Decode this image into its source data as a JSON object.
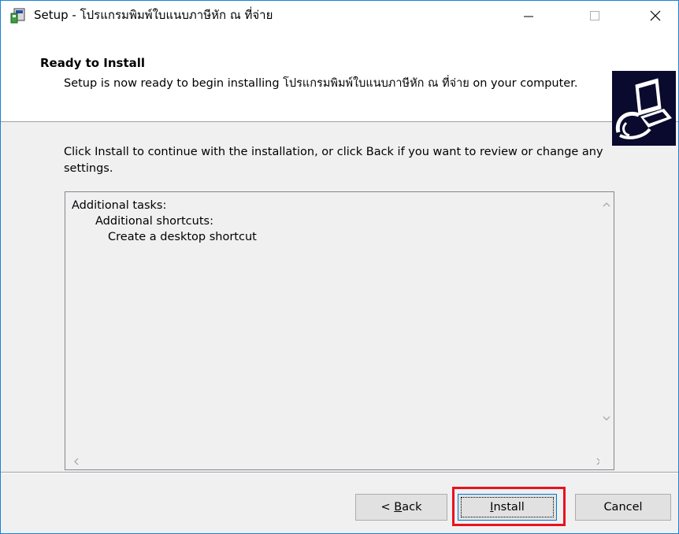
{
  "window": {
    "title": "Setup - โปรแกรมพิมพ์ใบแนบภาษีหัก ณ ที่จ่าย"
  },
  "header": {
    "title": "Ready to Install",
    "description": "Setup is now ready to begin installing โปรแกรมพิมพ์ใบแนบภาษีหัก ณ ที่จ่าย on your computer."
  },
  "body": {
    "instructions": "Click Install to continue with the installation, or click Back if you want to review or change any settings.",
    "memo_lines": [
      "Additional tasks:",
      "Additional shortcuts:",
      "Create a desktop shortcut"
    ]
  },
  "buttons": {
    "back_prefix": "< ",
    "back_accel": "B",
    "back_rest": "ack",
    "install_accel": "I",
    "install_rest": "nstall",
    "cancel": "Cancel"
  },
  "colors": {
    "highlight": "#e8121f",
    "window_border": "#1883d7"
  }
}
